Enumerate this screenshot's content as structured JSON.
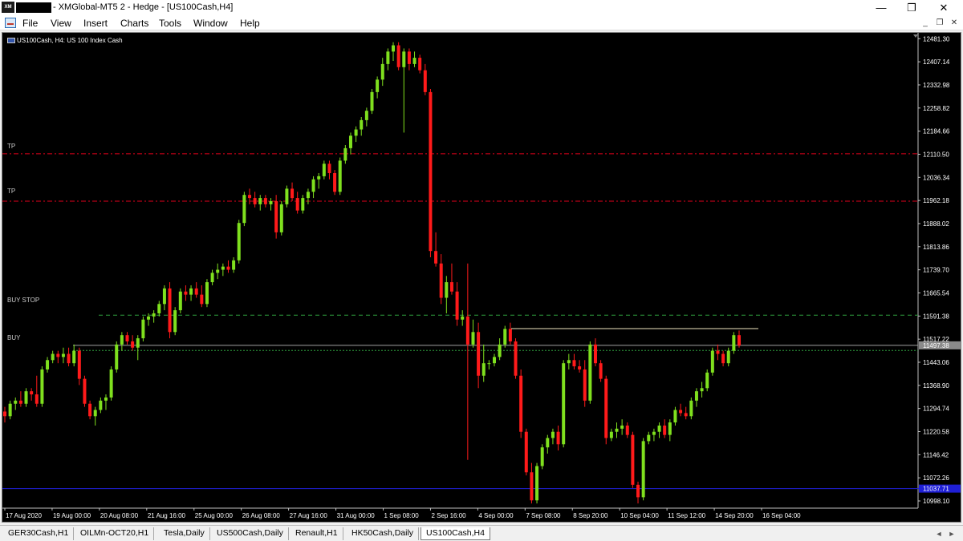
{
  "window": {
    "title": "- XMGlobal-MT5 2 - Hedge - [US100Cash,H4]",
    "logo_text": "XM",
    "minimize": "—",
    "maximize": "❐",
    "close": "✕"
  },
  "menu": [
    "File",
    "View",
    "Insert",
    "Charts",
    "Tools",
    "Window",
    "Help"
  ],
  "mdi_controls": [
    "_",
    "❐",
    "✕"
  ],
  "chart": {
    "label": "US100Cash, H4:  US 100 Index Cash",
    "lines": {
      "tp1": {
        "label": "TP",
        "price": 12112,
        "color": "#e0001b"
      },
      "tp2": {
        "label": "TP",
        "price": 11960,
        "color": "#e0001b"
      },
      "buy_stop": {
        "label": "BUY STOP",
        "price": 11594,
        "color": "#2e9e3e"
      },
      "buy": {
        "label": "BUY",
        "price": 11497.38,
        "color": "#a0a0a0"
      },
      "buy_dotted": {
        "price": 11481,
        "color": "#2e9e3e"
      },
      "bottom_blue": {
        "price": 11037.71,
        "color": "#1f1fd6"
      },
      "resistance": {
        "price": 11551,
        "color": "#f0e6c0"
      }
    },
    "current_price_label": "11497.38",
    "blue_price_label": "11037.71",
    "colors": {
      "bull": "#7fe01e",
      "bear": "#ff1a1a",
      "axis_text": "#ffffff",
      "background": "#000000"
    }
  },
  "chart_data": {
    "type": "candlestick",
    "price_axis": [
      "12481.30",
      "12407.14",
      "12332.98",
      "12258.82",
      "12184.66",
      "12110.50",
      "12036.34",
      "11962.18",
      "11888.02",
      "11813.86",
      "11739.70",
      "11665.54",
      "11591.38",
      "11517.22",
      "11443.06",
      "11368.90",
      "11294.74",
      "11220.58",
      "11146.42",
      "11072.26",
      "10998.10"
    ],
    "time_axis": [
      "17 Aug 2020",
      "19 Aug 00:00",
      "20 Aug 08:00",
      "21 Aug 16:00",
      "25 Aug 00:00",
      "26 Aug 08:00",
      "27 Aug 16:00",
      "31 Aug 00:00",
      "1 Sep 08:00",
      "2 Sep 16:00",
      "4 Sep 00:00",
      "7 Sep 08:00",
      "8 Sep 20:00",
      "10 Sep 04:00",
      "11 Sep 12:00",
      "14 Sep 20:00",
      "16 Sep 04:00"
    ],
    "ylim": [
      10975,
      12500
    ],
    "candles": [
      [
        11285,
        11300,
        11250,
        11270
      ],
      [
        11270,
        11320,
        11260,
        11310
      ],
      [
        11310,
        11330,
        11290,
        11320
      ],
      [
        11320,
        11350,
        11300,
        11310
      ],
      [
        11310,
        11360,
        11300,
        11350
      ],
      [
        11350,
        11360,
        11320,
        11340
      ],
      [
        11340,
        11400,
        11300,
        11310
      ],
      [
        11310,
        11430,
        11300,
        11420
      ],
      [
        11420,
        11460,
        11410,
        11450
      ],
      [
        11450,
        11480,
        11440,
        11470
      ],
      [
        11470,
        11480,
        11440,
        11460
      ],
      [
        11460,
        11490,
        11440,
        11470
      ],
      [
        11470,
        11490,
        11430,
        11440
      ],
      [
        11440,
        11500,
        11430,
        11480
      ],
      [
        11480,
        11490,
        11370,
        11390
      ],
      [
        11390,
        11400,
        11300,
        11310
      ],
      [
        11310,
        11320,
        11260,
        11270
      ],
      [
        11270,
        11300,
        11240,
        11290
      ],
      [
        11290,
        11330,
        11280,
        11320
      ],
      [
        11320,
        11340,
        11290,
        11330
      ],
      [
        11330,
        11430,
        11320,
        11420
      ],
      [
        11420,
        11510,
        11410,
        11500
      ],
      [
        11500,
        11540,
        11480,
        11530
      ],
      [
        11530,
        11540,
        11500,
        11510
      ],
      [
        11510,
        11530,
        11480,
        11490
      ],
      [
        11490,
        11530,
        11450,
        11520
      ],
      [
        11520,
        11590,
        11510,
        11580
      ],
      [
        11580,
        11600,
        11560,
        11590
      ],
      [
        11590,
        11610,
        11570,
        11600
      ],
      [
        11600,
        11640,
        11590,
        11630
      ],
      [
        11630,
        11690,
        11610,
        11680
      ],
      [
        11680,
        11700,
        11520,
        11540
      ],
      [
        11540,
        11620,
        11530,
        11610
      ],
      [
        11610,
        11680,
        11600,
        11670
      ],
      [
        11670,
        11690,
        11640,
        11660
      ],
      [
        11660,
        11690,
        11640,
        11680
      ],
      [
        11680,
        11700,
        11650,
        11660
      ],
      [
        11660,
        11690,
        11620,
        11630
      ],
      [
        11630,
        11710,
        11620,
        11700
      ],
      [
        11700,
        11740,
        11690,
        11730
      ],
      [
        11730,
        11760,
        11710,
        11740
      ],
      [
        11740,
        11760,
        11720,
        11750
      ],
      [
        11750,
        11770,
        11730,
        11740
      ],
      [
        11740,
        11780,
        11730,
        11770
      ],
      [
        11770,
        11900,
        11760,
        11890
      ],
      [
        11890,
        11990,
        11880,
        11980
      ],
      [
        11980,
        12000,
        11950,
        11970
      ],
      [
        11970,
        11990,
        11940,
        11950
      ],
      [
        11950,
        11980,
        11930,
        11970
      ],
      [
        11970,
        11980,
        11940,
        11950
      ],
      [
        11950,
        11970,
        11930,
        11960
      ],
      [
        11960,
        11980,
        11840,
        11860
      ],
      [
        11860,
        11960,
        11850,
        11950
      ],
      [
        11950,
        12010,
        11940,
        12000
      ],
      [
        12000,
        12020,
        11960,
        11970
      ],
      [
        11970,
        11990,
        11920,
        11930
      ],
      [
        11930,
        11980,
        11920,
        11970
      ],
      [
        11970,
        12000,
        11950,
        11990
      ],
      [
        11990,
        12040,
        11970,
        12030
      ],
      [
        12030,
        12050,
        12000,
        12040
      ],
      [
        12040,
        12090,
        12030,
        12080
      ],
      [
        12080,
        12090,
        12030,
        12050
      ],
      [
        12050,
        12060,
        11980,
        11990
      ],
      [
        11990,
        12100,
        11980,
        12090
      ],
      [
        12090,
        12140,
        12080,
        12130
      ],
      [
        12130,
        12180,
        12110,
        12170
      ],
      [
        12170,
        12200,
        12150,
        12190
      ],
      [
        12190,
        12230,
        12170,
        12220
      ],
      [
        12220,
        12260,
        12200,
        12250
      ],
      [
        12250,
        12320,
        12240,
        12310
      ],
      [
        12310,
        12360,
        12290,
        12350
      ],
      [
        12350,
        12420,
        12330,
        12400
      ],
      [
        12400,
        12450,
        12380,
        12440
      ],
      [
        12440,
        12470,
        12410,
        12460
      ],
      [
        12460,
        12470,
        12380,
        12390
      ],
      [
        12390,
        12450,
        12180,
        12440
      ],
      [
        12440,
        12450,
        12380,
        12400
      ],
      [
        12400,
        12440,
        12390,
        12420
      ],
      [
        12420,
        12430,
        12370,
        12380
      ],
      [
        12380,
        12400,
        12300,
        12310
      ],
      [
        12310,
        12320,
        11780,
        11800
      ],
      [
        11800,
        11860,
        11750,
        11760
      ],
      [
        11760,
        11790,
        11630,
        11650
      ],
      [
        11650,
        11720,
        11600,
        11700
      ],
      [
        11700,
        11760,
        11660,
        11670
      ],
      [
        11670,
        11700,
        11560,
        11580
      ],
      [
        11580,
        11610,
        11560,
        11590
      ],
      [
        11590,
        11760,
        11130,
        11500
      ],
      [
        11500,
        11580,
        11490,
        11540
      ],
      [
        11540,
        11570,
        11360,
        11400
      ],
      [
        11400,
        11500,
        11380,
        11440
      ],
      [
        11440,
        11450,
        11420,
        11440
      ],
      [
        11440,
        11470,
        11430,
        11460
      ],
      [
        11460,
        11520,
        11450,
        11500
      ],
      [
        11500,
        11560,
        11490,
        11550
      ],
      [
        11550,
        11570,
        11500,
        11510
      ],
      [
        11510,
        11520,
        11390,
        11400
      ],
      [
        11400,
        11420,
        11200,
        11220
      ],
      [
        11220,
        11230,
        11080,
        11090
      ],
      [
        11090,
        11120,
        10990,
        11000
      ],
      [
        11000,
        11120,
        10990,
        11110
      ],
      [
        11110,
        11180,
        11100,
        11170
      ],
      [
        11170,
        11210,
        11150,
        11200
      ],
      [
        11200,
        11230,
        11180,
        11220
      ],
      [
        11220,
        11240,
        11160,
        11180
      ],
      [
        11180,
        11450,
        11170,
        11440
      ],
      [
        11440,
        11470,
        11420,
        11450
      ],
      [
        11450,
        11470,
        11420,
        11430
      ],
      [
        11430,
        11450,
        11410,
        11420
      ],
      [
        11420,
        11450,
        11300,
        11320
      ],
      [
        11320,
        11510,
        11310,
        11500
      ],
      [
        11500,
        11520,
        11430,
        11440
      ],
      [
        11440,
        11450,
        11380,
        11390
      ],
      [
        11390,
        11400,
        11180,
        11200
      ],
      [
        11200,
        11230,
        11190,
        11220
      ],
      [
        11220,
        11250,
        11200,
        11230
      ],
      [
        11230,
        11260,
        11210,
        11240
      ],
      [
        11240,
        11250,
        11200,
        11210
      ],
      [
        11210,
        11220,
        11040,
        11050
      ],
      [
        11050,
        11060,
        10990,
        11010
      ],
      [
        11010,
        11200,
        11000,
        11190
      ],
      [
        11190,
        11220,
        11180,
        11210
      ],
      [
        11210,
        11230,
        11190,
        11220
      ],
      [
        11220,
        11250,
        11200,
        11240
      ],
      [
        11240,
        11260,
        11200,
        11210
      ],
      [
        11210,
        11260,
        11190,
        11250
      ],
      [
        11250,
        11300,
        11240,
        11290
      ],
      [
        11290,
        11310,
        11270,
        11280
      ],
      [
        11280,
        11300,
        11260,
        11270
      ],
      [
        11270,
        11330,
        11260,
        11320
      ],
      [
        11320,
        11360,
        11300,
        11350
      ],
      [
        11350,
        11380,
        11330,
        11360
      ],
      [
        11360,
        11420,
        11350,
        11410
      ],
      [
        11410,
        11490,
        11400,
        11480
      ],
      [
        11480,
        11500,
        11450,
        11470
      ],
      [
        11470,
        11480,
        11430,
        11440
      ],
      [
        11440,
        11490,
        11430,
        11480
      ],
      [
        11480,
        11540,
        11470,
        11530
      ],
      [
        11530,
        11545,
        11490,
        11497
      ]
    ]
  },
  "tabs": [
    "GER30Cash,H1",
    "OILMn-OCT20,H1",
    "Tesla,Daily",
    "US500Cash,Daily",
    "Renault,H1",
    "HK50Cash,Daily",
    "US100Cash,H4"
  ],
  "active_tab": "US100Cash,H4",
  "tab_scroll": [
    "◄",
    "►"
  ]
}
